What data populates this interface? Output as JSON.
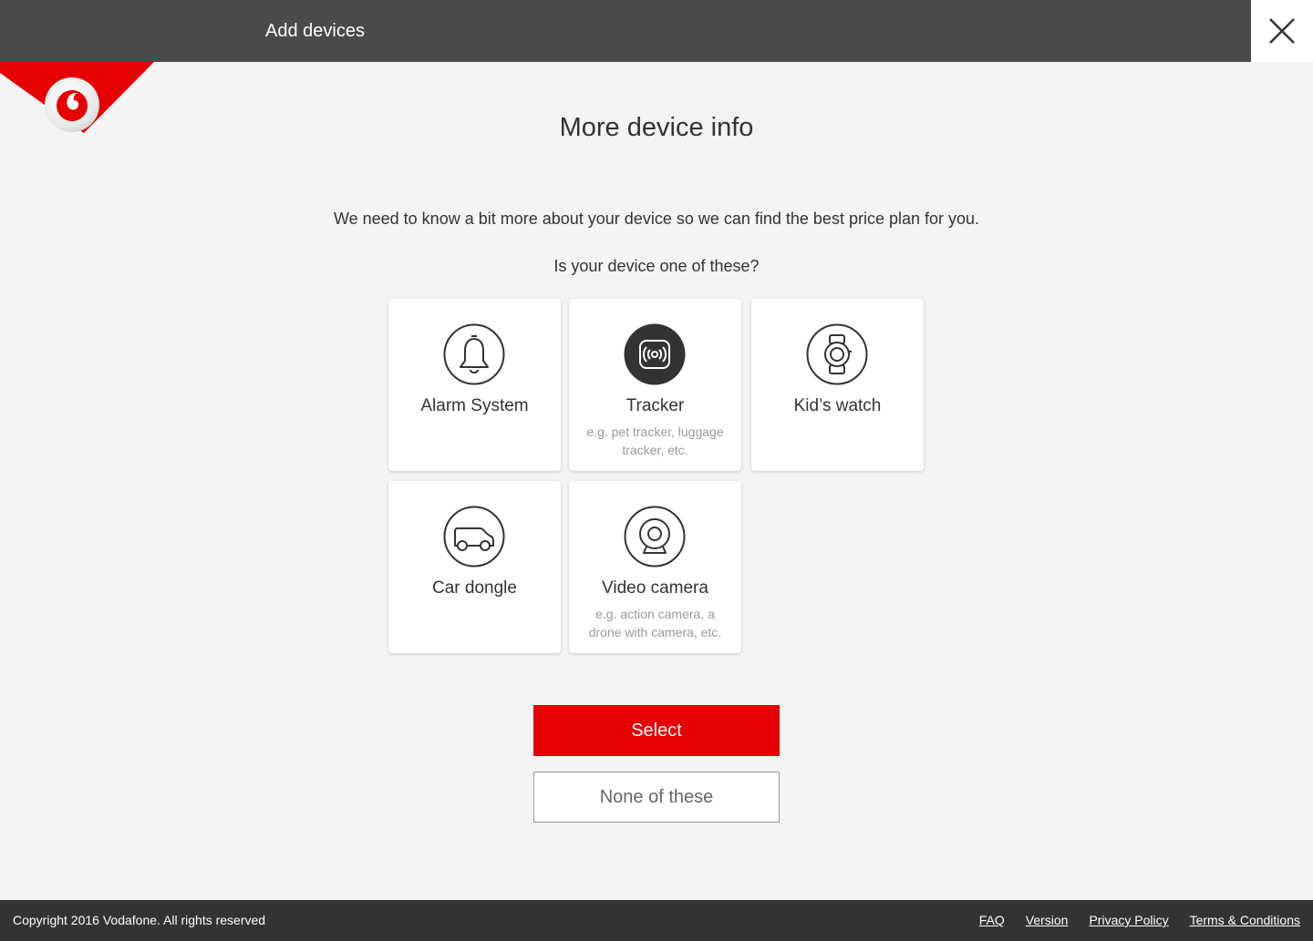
{
  "header": {
    "title": "Add devices",
    "close_icon": "close-icon"
  },
  "brand": {
    "logo_icon": "vodafone-logo",
    "accent": "#e60000"
  },
  "main": {
    "title": "More device info",
    "intro": "We need to know a bit more about your device so we can find the best price plan for you.",
    "question": "Is your device one of these?",
    "devices": [
      {
        "label": "Alarm System",
        "hint": "",
        "icon": "bell-icon",
        "selected": false
      },
      {
        "label": "Tracker",
        "hint": "e.g. pet tracker, luggage tracker, etc.",
        "icon": "tracker-icon",
        "selected": true
      },
      {
        "label": "Kid’s watch",
        "hint": "",
        "icon": "watch-icon",
        "selected": false
      },
      {
        "label": "Car dongle",
        "hint": "",
        "icon": "car-icon",
        "selected": false
      },
      {
        "label": "Video camera",
        "hint": "e.g. action camera, a drone with camera, etc.",
        "icon": "webcam-icon",
        "selected": false
      }
    ],
    "select_label": "Select",
    "none_label": "None of these"
  },
  "footer": {
    "copyright": "Copyright 2016 Vodafone. All rights reserved",
    "links": [
      "FAQ",
      "Version",
      "Privacy Policy",
      "Terms & Conditions"
    ]
  }
}
